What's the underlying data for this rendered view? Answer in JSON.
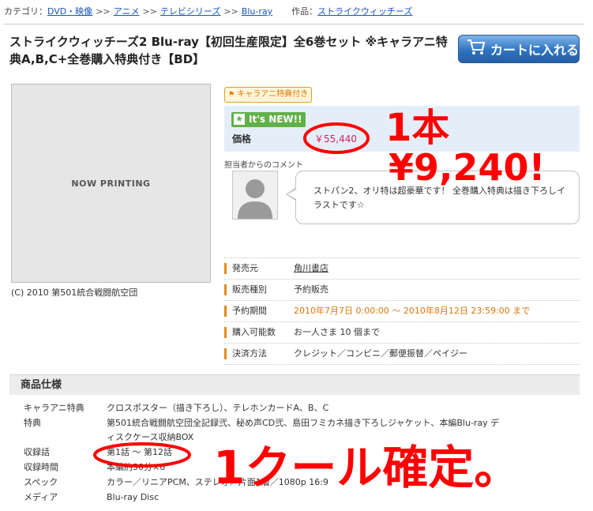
{
  "breadcrumb": {
    "category_label": "カテゴリ：",
    "items": [
      "DVD・映像",
      "アニメ",
      "テレビシリーズ",
      "Blu-ray"
    ],
    "separator": ">>",
    "work_label": "作品：",
    "work_link": "ストライクウィッチーズ"
  },
  "product": {
    "title": "ストライクウィッチーズ2 Blu-ray【初回生産限定】全6巻セット ※キャラアニ特典A,B,C+全巻購入特典付き【BD】",
    "cover_placeholder": "NOW PRINTING",
    "copyright": "(C) 2010 第501統合戦闘航空団",
    "cart_button": "カートに入れる",
    "badge_tokuten": "キャラアニ特典付き",
    "new_badge": "It's NEW!!",
    "price_label": "価格",
    "price_value": "￥55,440"
  },
  "comment": {
    "label": "担当者からのコメント",
    "text": "ストパン2、オリ特は超豪華です！ 全巻購入特典は描き下ろしイラストです☆"
  },
  "info": [
    {
      "key": "発売元",
      "value": "角川書店",
      "style": "link"
    },
    {
      "key": "販売種別",
      "value": "予約販売",
      "style": "plain"
    },
    {
      "key": "予約期間",
      "value": "2010年7月7日 0:00:00 ～ 2010年8月12日 23:59:00 まで",
      "style": "orange"
    },
    {
      "key": "購入可能数",
      "value": "お一人さま 10 個まで",
      "style": "plain"
    },
    {
      "key": "決済方法",
      "value": "クレジット／コンビニ／郵便振替／ペイジー",
      "style": "plain"
    }
  ],
  "spec": {
    "heading": "商品仕様",
    "rows": [
      {
        "key": "キャラアニ特典",
        "value": "クロスポスター（描き下ろし）、テレホンカードA、B、C"
      },
      {
        "key": "特典",
        "value": "第501統合戦闘航空団全記録弐、秘め声CD弐、島田フミカネ描き下ろしジャケット、本編Blu-ray ディスクケース収納BOX"
      },
      {
        "key": "収録話",
        "value": "第1話 ～ 第12話"
      },
      {
        "key": "収録時間",
        "value": "本編約50分×6"
      },
      {
        "key": "スペック",
        "value": "カラー／リニアPCM、ステレオ／片面1層／1080p 16:9"
      },
      {
        "key": "メディア",
        "value": "Blu-ray Disc"
      }
    ]
  },
  "annotations": {
    "per_unit": "1本",
    "per_unit_price": "¥9,240!",
    "one_cour": "1クール確定。"
  },
  "colors": {
    "accent_orange": "#e38a1a",
    "price_pink": "#d4225e",
    "cart_blue": "#2f74c0",
    "annotation_red": "#ff0000"
  }
}
